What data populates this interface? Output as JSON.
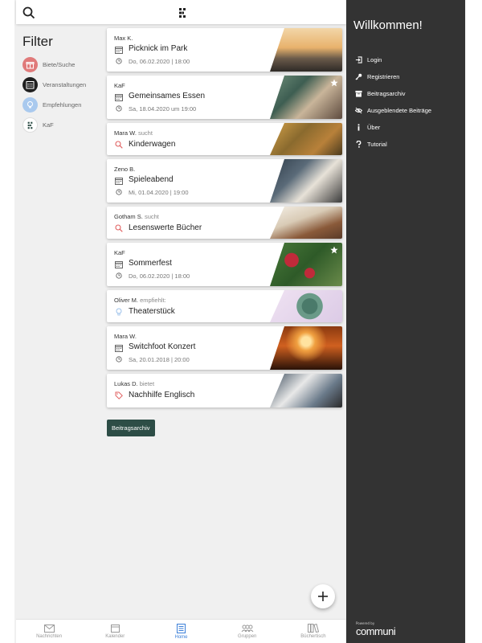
{
  "filter": {
    "title": "Filter",
    "items": [
      {
        "label": "Biete/Suche",
        "icon": "gift-icon",
        "color": "#e07a7a"
      },
      {
        "label": "Veranstaltungen",
        "icon": "calendar-icon",
        "color": "#1f1f1f"
      },
      {
        "label": "Empfehlungen",
        "icon": "lightbulb-icon",
        "color": "#a9c9ee"
      },
      {
        "label": "KaF",
        "icon": "kaf-logo-icon",
        "color": "#ffffff"
      }
    ]
  },
  "feed": [
    {
      "author": "Max K.",
      "verb": "",
      "title": "Picknick im Park",
      "date": "Do, 06.02.2020 | 18:00",
      "type": "event",
      "starred": false,
      "image": "city-skyline-sunset"
    },
    {
      "author": "KaF",
      "verb": "",
      "title": "Gemeinsames Essen",
      "date": "Sa, 18.04.2020 um 19:00",
      "type": "event",
      "starred": true,
      "image": "women-drinking"
    },
    {
      "author": "Mara W.",
      "verb": "sucht",
      "title": "Kinderwagen",
      "date": "",
      "type": "search",
      "starred": false,
      "image": "autumn-park"
    },
    {
      "author": "Zeno B.",
      "verb": "",
      "title": "Spieleabend",
      "date": "Mi, 01.04.2020 | 19:00",
      "type": "event",
      "starred": false,
      "image": "board-game"
    },
    {
      "author": "Gotham S.",
      "verb": "sucht",
      "title": "Lesenswerte Bücher",
      "date": "",
      "type": "search",
      "starred": false,
      "image": "open-book"
    },
    {
      "author": "KaF",
      "verb": "",
      "title": "Sommerfest",
      "date": "Do, 06.02.2020 | 18:00",
      "type": "event",
      "starred": true,
      "image": "raspberries"
    },
    {
      "author": "Oliver M.",
      "verb": "empfiehlt:",
      "title": "Theaterstück",
      "date": "",
      "type": "recommend",
      "starred": false,
      "image": "succulent"
    },
    {
      "author": "Mara W.",
      "verb": "",
      "title": "Switchfoot Konzert",
      "date": "Sa, 20.01.2018 | 20:00",
      "type": "event",
      "starred": false,
      "image": "concert-crowd"
    },
    {
      "author": "Lukas D.",
      "verb": "bietet",
      "title": "Nachhilfe Englisch",
      "date": "",
      "type": "offer",
      "starred": false,
      "image": "desk-study"
    }
  ],
  "archive_button": "Beitragsarchiv",
  "bottom_nav": [
    {
      "label": "Nachrichten",
      "icon": "mail-icon",
      "active": false
    },
    {
      "label": "Kalender",
      "icon": "calendar-icon",
      "active": false
    },
    {
      "label": "Home",
      "icon": "home-list-icon",
      "active": true
    },
    {
      "label": "Gruppen",
      "icon": "group-icon",
      "active": false
    },
    {
      "label": "Büchertisch",
      "icon": "books-icon",
      "active": false
    }
  ],
  "sidebar": {
    "title": "Willkommen!",
    "items": [
      {
        "label": "Login",
        "icon": "login-icon"
      },
      {
        "label": "Registrieren",
        "icon": "key-icon"
      },
      {
        "label": "Beitragsarchiv",
        "icon": "archive-icon"
      },
      {
        "label": "Ausgeblendete Beiträge",
        "icon": "eye-off-icon"
      },
      {
        "label": "Über",
        "icon": "info-icon"
      },
      {
        "label": "Tutorial",
        "icon": "question-icon"
      }
    ],
    "powered_by": "Powered by",
    "brand": "communi"
  },
  "colors": {
    "accent": "#3b7fd8",
    "archive_button": "#2d4d46",
    "sidebar_bg": "#333333",
    "search_icon": "#e06060"
  }
}
